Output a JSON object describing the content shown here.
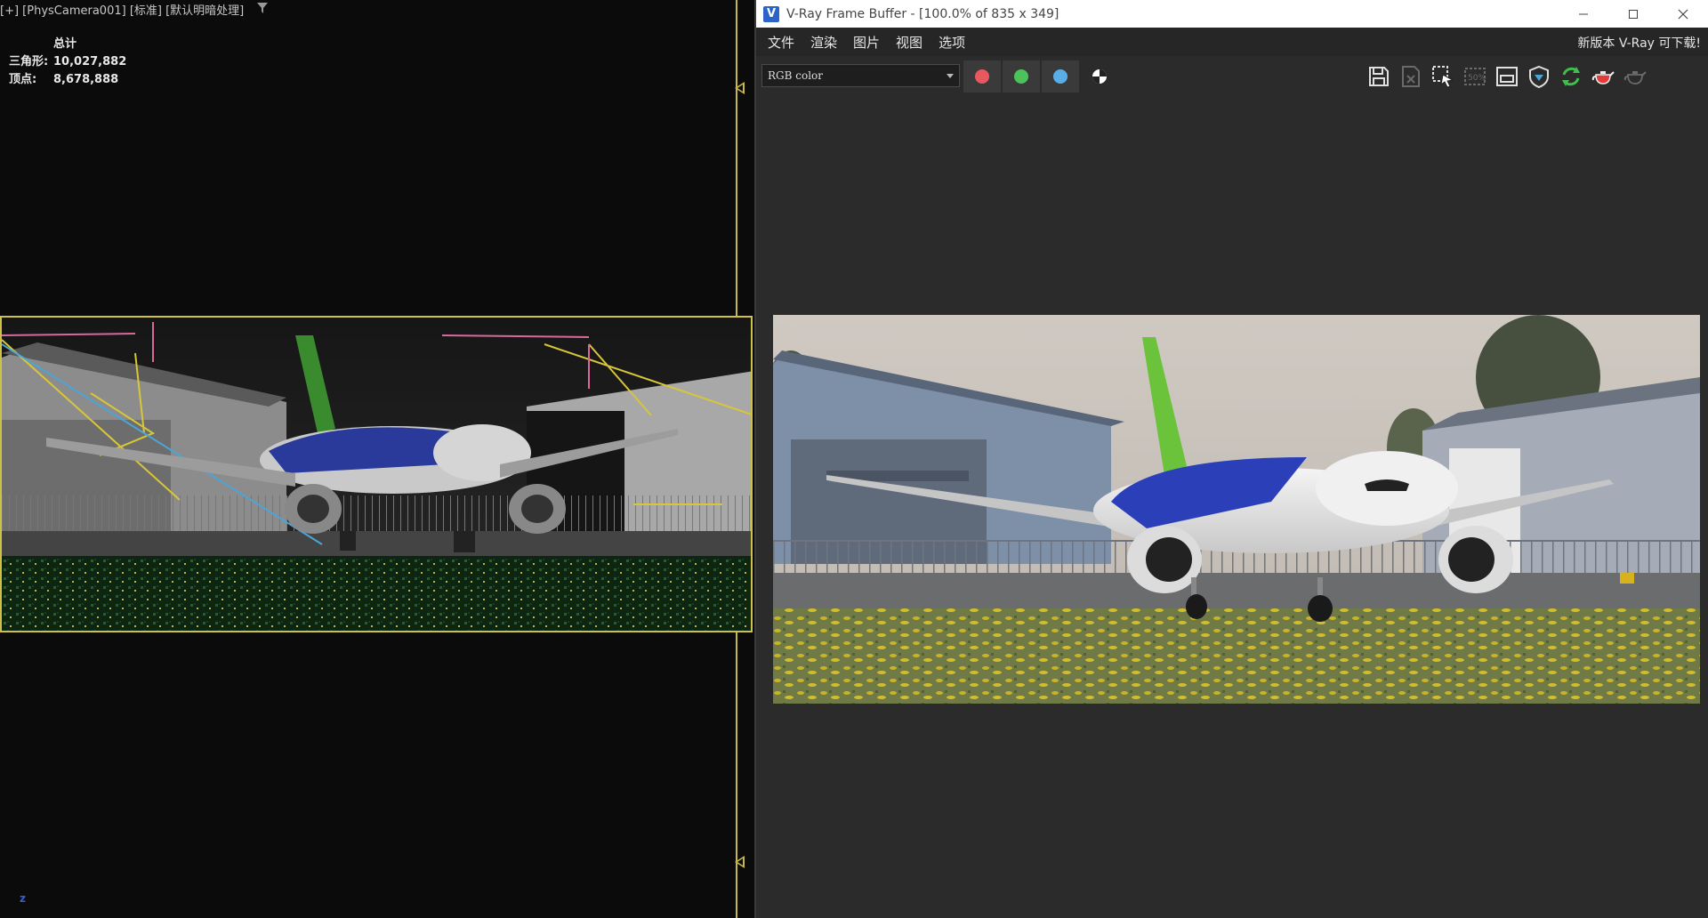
{
  "viewport": {
    "label": "[+] [PhysCamera001] [标准] [默认明暗处理]",
    "stats": {
      "title": "总计",
      "triangles_label": "三角形:",
      "triangles_value": "10,027,882",
      "vertices_label": "顶点:",
      "vertices_value": "8,678,888"
    },
    "axis_label": "z"
  },
  "vfb": {
    "window_title": "V-Ray Frame Buffer - [100.0% of 835 x 349]",
    "menu": [
      "文件",
      "渲染",
      "图片",
      "视图",
      "选项"
    ],
    "update_notice": "新版本 V-Ray 可下载!",
    "channel": "RGB color",
    "channel_colors": {
      "red": "#e8595f",
      "green": "#4cc35a",
      "blue": "#5aaee8"
    },
    "toolbar_icons": [
      "save-icon",
      "clear-icon",
      "region-select-icon",
      "compare-icon",
      "frame-icon",
      "lens-effects-icon",
      "refresh-icon",
      "render-teapot-icon",
      "teapot-icon"
    ]
  }
}
